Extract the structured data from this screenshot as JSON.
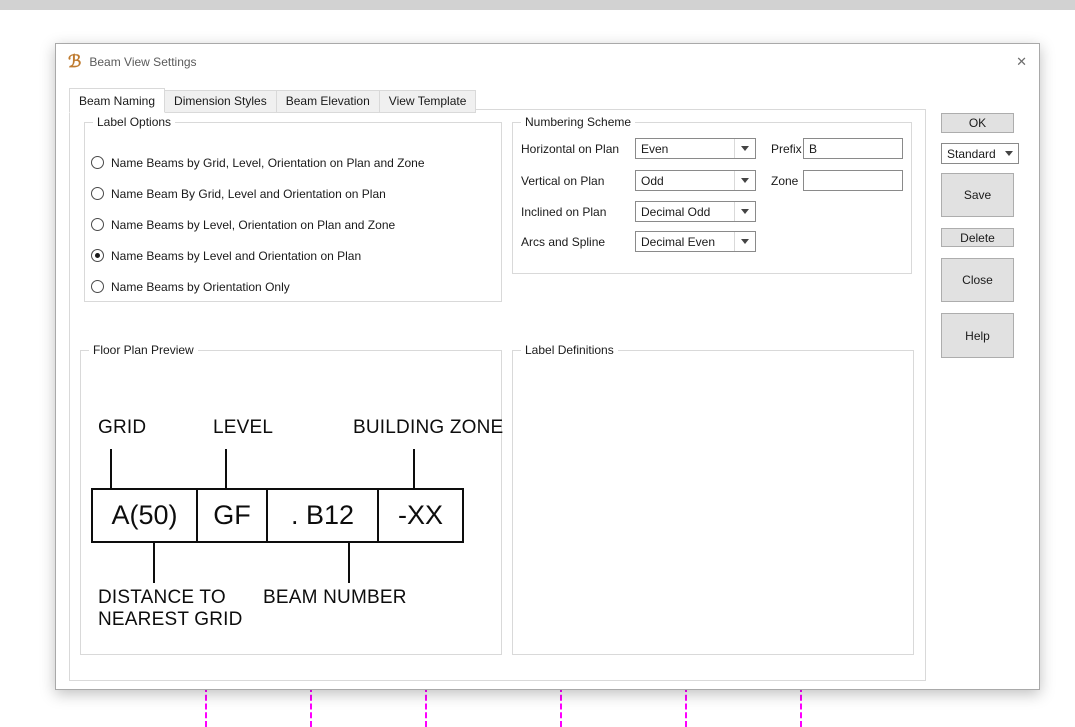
{
  "window": {
    "title": "Beam View Settings",
    "icon_glyph": "ℬ",
    "close_glyph": "✕"
  },
  "tabs": [
    {
      "label": "Beam Naming",
      "active": true
    },
    {
      "label": "Dimension Styles",
      "active": false
    },
    {
      "label": "Beam Elevation",
      "active": false
    },
    {
      "label": "View Template",
      "active": false
    }
  ],
  "label_options": {
    "title": "Label Options",
    "options": [
      {
        "label": "Name Beams by Grid, Level,  Orientation on Plan and Zone",
        "selected": false
      },
      {
        "label": "Name Beam By Grid, Level and Orientation on Plan",
        "selected": false
      },
      {
        "label": "Name Beams by Level, Orientation on Plan and Zone",
        "selected": false
      },
      {
        "label": "Name Beams by Level and Orientation on Plan",
        "selected": true
      },
      {
        "label": "Name Beams by Orientation Only",
        "selected": false
      }
    ]
  },
  "numbering_scheme": {
    "title": "Numbering Scheme",
    "rows": [
      {
        "label": "Horizontal on Plan",
        "value": "Even"
      },
      {
        "label": "Vertical on Plan",
        "value": "Odd"
      },
      {
        "label": "Inclined on Plan",
        "value": "Decimal Odd"
      },
      {
        "label": "Arcs and Spline",
        "value": "Decimal Even"
      }
    ],
    "prefix_label": "Prefix",
    "prefix_value": "B",
    "zone_label": "Zone",
    "zone_value": ""
  },
  "floor_plan_preview": {
    "title": "Floor Plan Preview",
    "top_labels": [
      "GRID",
      "LEVEL",
      "BUILDING ZONE"
    ],
    "boxes": [
      "A(50)",
      "GF",
      ". B12",
      "-XX"
    ],
    "bottom_left_line1": "DISTANCE TO",
    "bottom_left_line2": "NEAREST GRID",
    "bottom_right": "BEAM NUMBER"
  },
  "label_definitions": {
    "title": "Label Definitions"
  },
  "side_panel": {
    "ok": "OK",
    "preset": "Standard",
    "save": "Save",
    "delete": "Delete",
    "close": "Close",
    "help": "Help"
  },
  "colors": {
    "cad_grid_line": "#ff00ff",
    "app_icon": "#bf7b2f"
  }
}
